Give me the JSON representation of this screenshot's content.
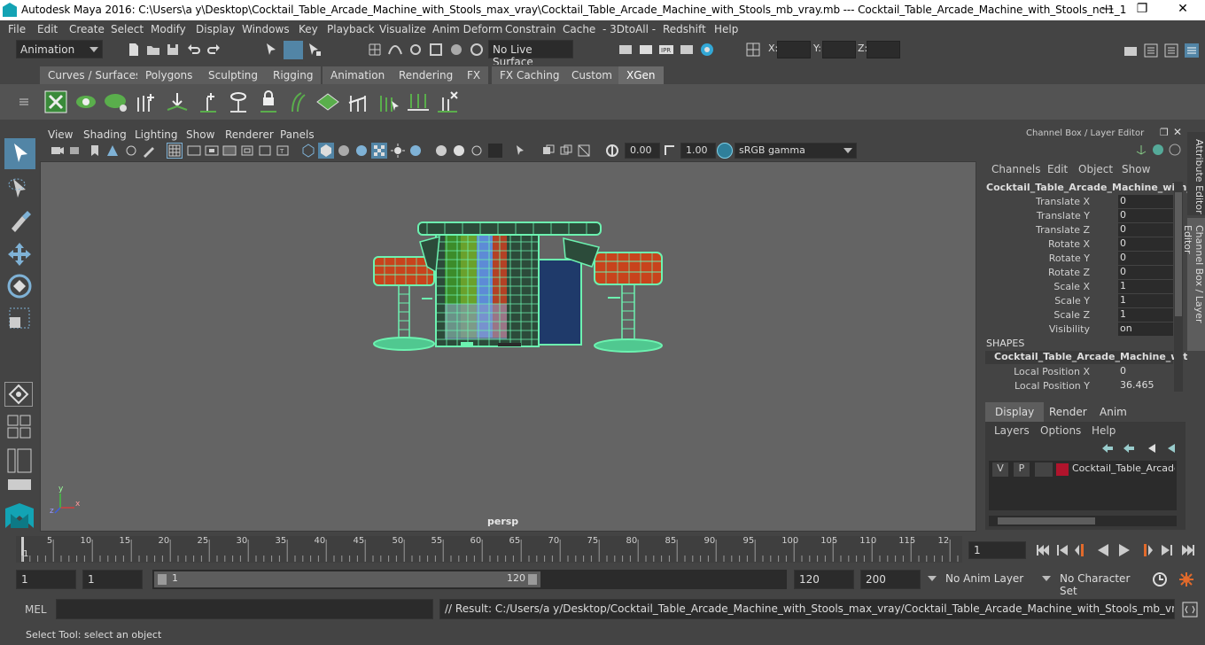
{
  "window": {
    "title": "Autodesk Maya 2016: C:\\Users\\a y\\Desktop\\Cocktail_Table_Arcade_Machine_with_Stools_max_vray\\Cocktail_Table_Arcade_Machine_with_Stools_mb_vray.mb    ---   Cocktail_Table_Arcade_Machine_with_Stools_ncl1_1",
    "minimize": "—",
    "maximize": "❐",
    "close": "✕"
  },
  "menu": [
    "File",
    "Edit",
    "Create",
    "Select",
    "Modify",
    "Display",
    "Windows",
    "Key",
    "Playback",
    "Visualize",
    "Anim Deform",
    "Constrain",
    "Cache",
    "- 3DtoAll -",
    "Redshift",
    "Help"
  ],
  "status": {
    "mode": "Animation",
    "live_surface": "No Live Surface",
    "x_label": "X:",
    "y_label": "Y:",
    "z_label": "Z:"
  },
  "shelf_tabs": [
    "Curves / Surfaces",
    "Polygons",
    "Sculpting",
    "Rigging",
    "Animation",
    "Rendering",
    "FX",
    "FX Caching",
    "Custom",
    "XGen"
  ],
  "active_shelf_tab": "XGen",
  "viewport": {
    "menu": [
      "View",
      "Shading",
      "Lighting",
      "Show",
      "Renderer",
      "Panels"
    ],
    "exposure": "0.00",
    "gamma": "1.00",
    "color_space": "sRGB gamma",
    "camera": "persp",
    "axis_x": "x",
    "axis_y": "y",
    "axis_z": "z"
  },
  "channel_box": {
    "title": "Channel Box / Layer Editor",
    "menu": [
      "Channels",
      "Edit",
      "Object",
      "Show"
    ],
    "object": "Cocktail_Table_Arcade_Machine_with_...",
    "attrs": [
      {
        "label": "Translate X",
        "value": "0"
      },
      {
        "label": "Translate Y",
        "value": "0"
      },
      {
        "label": "Translate Z",
        "value": "0"
      },
      {
        "label": "Rotate X",
        "value": "0"
      },
      {
        "label": "Rotate Y",
        "value": "0"
      },
      {
        "label": "Rotate Z",
        "value": "0"
      },
      {
        "label": "Scale X",
        "value": "1"
      },
      {
        "label": "Scale Y",
        "value": "1"
      },
      {
        "label": "Scale Z",
        "value": "1"
      },
      {
        "label": "Visibility",
        "value": "on"
      }
    ],
    "shapes_header": "SHAPES",
    "shape_name": "Cocktail_Table_Arcade_Machine_wit...",
    "shape_attrs": [
      {
        "label": "Local Position X",
        "value": "0"
      },
      {
        "label": "Local Position Y",
        "value": "36.465"
      }
    ]
  },
  "side_tabs": [
    "Attribute Editor",
    "Channel Box / Layer Editor"
  ],
  "layer_editor": {
    "tabs": [
      "Display",
      "Render",
      "Anim"
    ],
    "menu": [
      "Layers",
      "Options",
      "Help"
    ],
    "layer": {
      "v": "V",
      "p": "P",
      "name": "Cocktail_Table_Arcade_M",
      "color": "#b0142c"
    }
  },
  "timeline": {
    "ticks": [
      "5",
      "10",
      "15",
      "20",
      "25",
      "30",
      "35",
      "40",
      "45",
      "50",
      "55",
      "60",
      "65",
      "70",
      "75",
      "80",
      "85",
      "90",
      "95",
      "100",
      "105",
      "110",
      "115",
      "12"
    ],
    "current_marker": "1",
    "current_frame": "1"
  },
  "range": {
    "start": "1",
    "start_inner": "1",
    "slider_start": "1",
    "slider_end": "120",
    "end_inner": "120",
    "end": "200",
    "anim_layer": "No Anim Layer",
    "character_set": "No Character Set"
  },
  "command": {
    "label": "MEL",
    "result": "// Result: C:/Users/a y/Desktop/Cocktail_Table_Arcade_Machine_with_Stools_max_vray/Cocktail_Table_Arcade_Machine_with_Stools_mb_vray.mb"
  },
  "help_line": "Select Tool: select an object",
  "colors": {
    "wire": "#6cf2b0",
    "accent_blue": "#5285a6",
    "stool_red": "#d2421d"
  }
}
